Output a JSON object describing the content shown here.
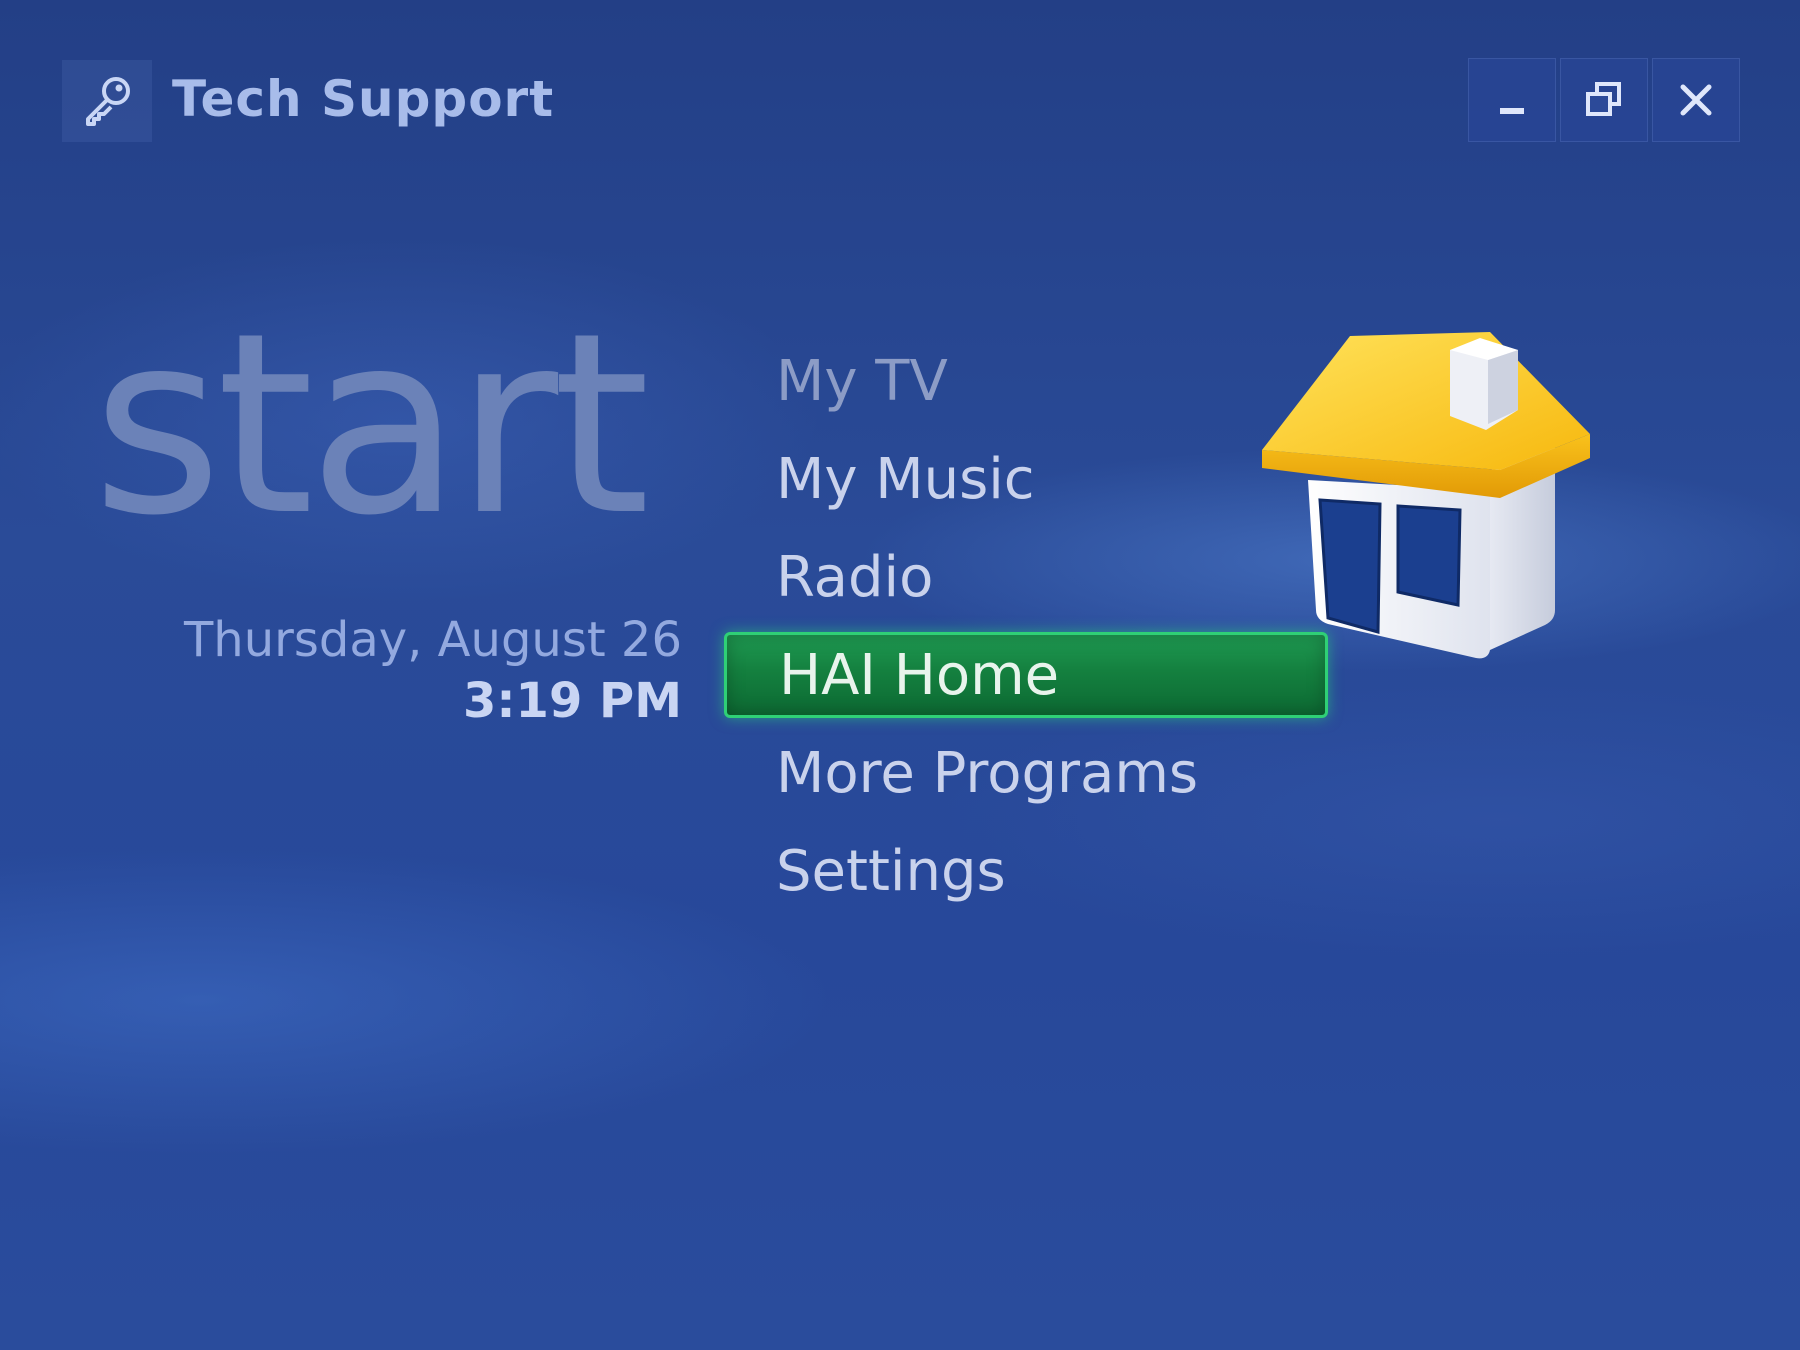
{
  "window": {
    "title": "Tech Support",
    "title_icon": "key-icon",
    "controls": [
      {
        "name": "minimize-button",
        "icon": "minimize-icon"
      },
      {
        "name": "restore-button",
        "icon": "restore-icon"
      },
      {
        "name": "close-button",
        "icon": "close-icon"
      }
    ]
  },
  "start_screen": {
    "heading": "start",
    "date": "Thursday, August 26",
    "time": "3:19 PM"
  },
  "menu": {
    "items": [
      {
        "label": "My TV"
      },
      {
        "label": "My Music"
      },
      {
        "label": "Radio"
      },
      {
        "label": "HAI Home"
      },
      {
        "label": "More Programs"
      },
      {
        "label": "Settings"
      }
    ],
    "focused_item": "HAI Home",
    "focus_color": "#1c8f4c",
    "focused_icon": "house-icon"
  },
  "colors": {
    "background": "#27489a",
    "focus_border": "#2fd076",
    "house_roof": "#f7c521"
  }
}
